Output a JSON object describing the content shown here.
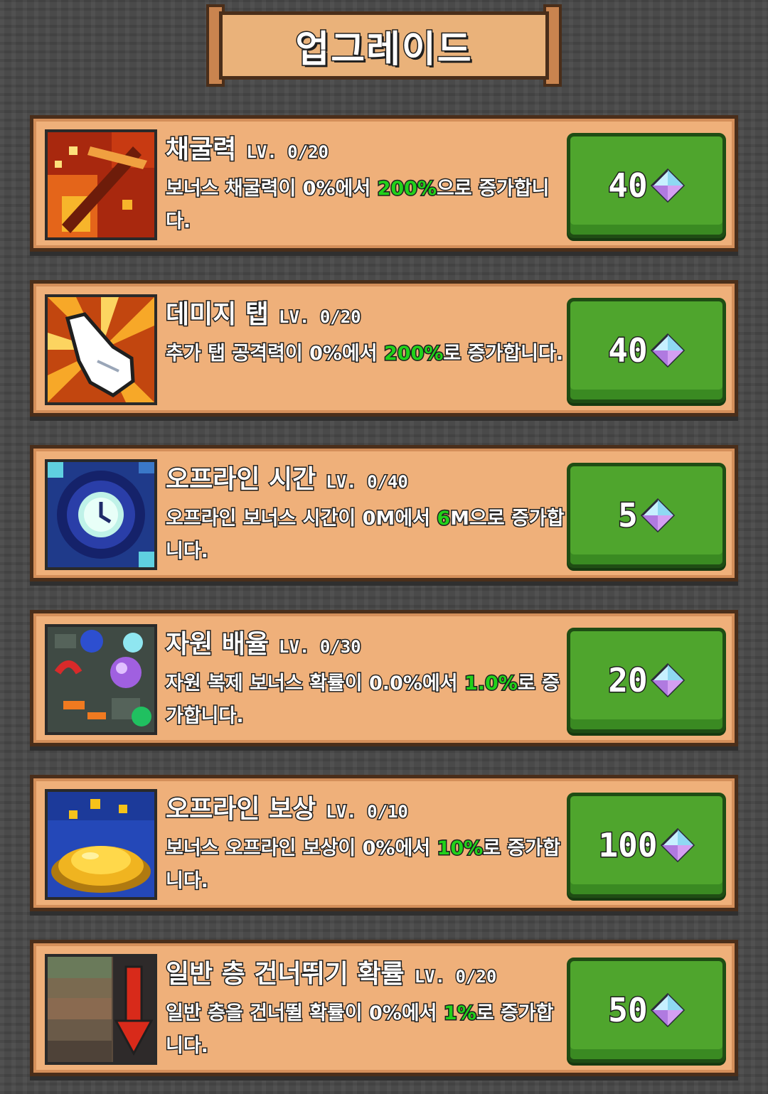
{
  "header": {
    "title": "업그레이드"
  },
  "currency_icon": "diamond-gem-icon",
  "colors": {
    "highlight": "#22d11a",
    "button": "#4fa52d",
    "card": "#efb07a"
  },
  "upgrades": [
    {
      "icon": "pickaxe-fire-icon",
      "name": "채굴력",
      "level": "LV. 0/20",
      "desc_pre": "보너스 채굴력이 0%에서 ",
      "desc_hl": "200%",
      "desc_post": "으로 증가합니다.",
      "price": "40"
    },
    {
      "icon": "tap-hand-icon",
      "name": "데미지 탭",
      "level": "LV. 0/20",
      "desc_pre": "추가 탭 공격력이 0%에서 ",
      "desc_hl": "200%",
      "desc_post": "로 증가합니다.",
      "price": "40"
    },
    {
      "icon": "clock-icon",
      "name": "오프라인 시간",
      "level": "LV. 0/40",
      "desc_pre": "오프라인 보너스 시간이 0M에서 ",
      "desc_hl": "6",
      "desc_post": "M으로 증가합니다.",
      "price": "5"
    },
    {
      "icon": "resource-ores-icon",
      "name": "자원 배율",
      "level": "LV. 0/30",
      "desc_pre": "자원 복제 보너스 확률이 0.0%에서 ",
      "desc_hl": "1.0%",
      "desc_post": "로 증가합니다.",
      "price": "20"
    },
    {
      "icon": "gold-pile-icon",
      "name": "오프라인 보상",
      "level": "LV. 0/10",
      "desc_pre": "보너스 오프라인 보상이 0%에서 ",
      "desc_hl": "10%",
      "desc_post": "로 증가합니다.",
      "price": "100"
    },
    {
      "icon": "floor-skip-arrow-icon",
      "name": "일반 층 건너뛰기 확률",
      "level": "LV. 0/20",
      "desc_pre": "일반 층을 건너뛸 확률이 0%에서 ",
      "desc_hl": "1%",
      "desc_post": "로 증가합니다.",
      "price": "50"
    }
  ]
}
